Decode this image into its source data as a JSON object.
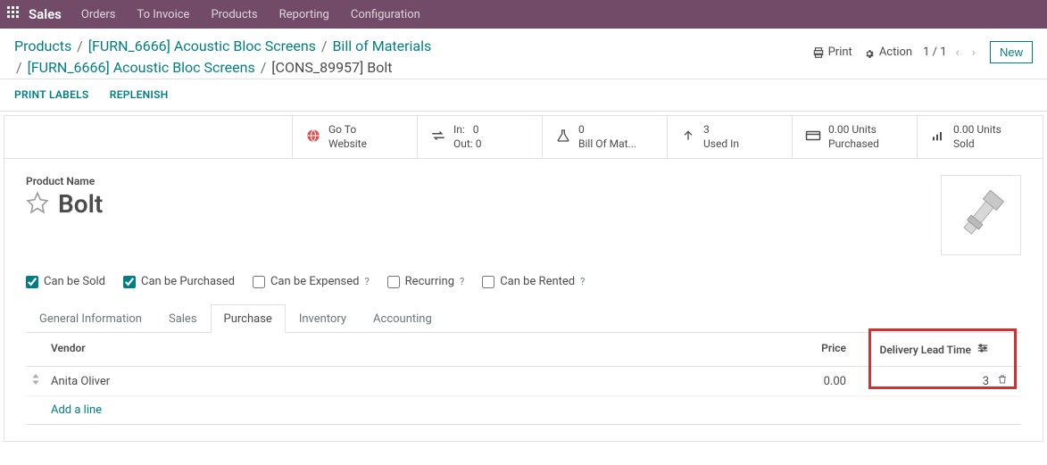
{
  "topbar": {
    "brand": "Sales",
    "menu": [
      "Orders",
      "To Invoice",
      "Products",
      "Reporting",
      "Configuration"
    ]
  },
  "breadcrumb": {
    "a": "Products",
    "b": "[FURN_6666] Acoustic Bloc Screens",
    "c": "Bill of Materials",
    "d": "[FURN_6666] Acoustic Bloc Screens",
    "e": "[CONS_89957] Bolt"
  },
  "actions": {
    "print": "Print",
    "action": "Action",
    "pager": "1 / 1",
    "new": "New"
  },
  "controls": {
    "print_labels": "PRINT LABELS",
    "replenish": "REPLENISH"
  },
  "stats": {
    "website_l1": "Go To",
    "website_l2": "Website",
    "inout_l1": "In:",
    "inout_v1": "0",
    "inout_l2": "Out:",
    "inout_v2": "0",
    "bom_v": "0",
    "bom_l": "Bill Of Mat...",
    "used_v": "3",
    "used_l": "Used In",
    "purch_v": "0.00 Units",
    "purch_l": "Purchased",
    "sold_v": "0.00 Units",
    "sold_l": "Sold"
  },
  "form": {
    "name_label": "Product Name",
    "name": "Bolt"
  },
  "checks": {
    "sold": "Can be Sold",
    "purchased": "Can be Purchased",
    "expensed": "Can be Expensed",
    "recurring": "Recurring",
    "rented": "Can be Rented"
  },
  "tabs": {
    "general": "General Information",
    "sales": "Sales",
    "purchase": "Purchase",
    "inventory": "Inventory",
    "accounting": "Accounting"
  },
  "grid": {
    "h_vendor": "Vendor",
    "h_price": "Price",
    "h_lead": "Delivery Lead Time",
    "rows": [
      {
        "vendor": "Anita Oliver",
        "price": "0.00",
        "lead": "3"
      }
    ],
    "add": "Add a line"
  }
}
